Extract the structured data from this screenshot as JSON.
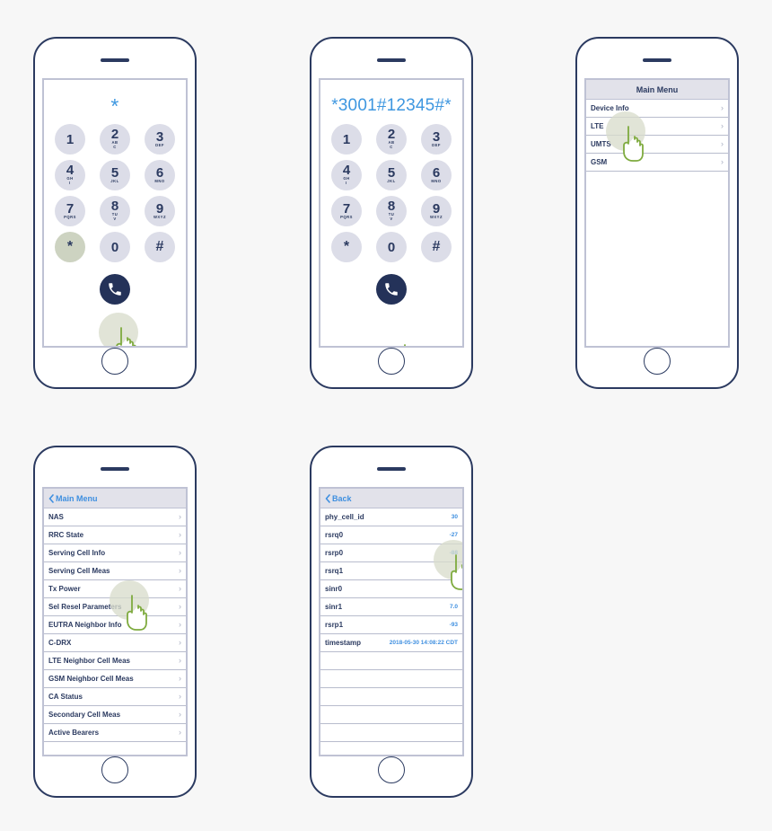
{
  "colors": {
    "frame": "#2b3a60",
    "screen_border": "#bfc2d4",
    "key_bg": "#dcdde8",
    "key_highlight": "#cdd3c1",
    "call_button": "#243259",
    "accent_blue": "#3e8fe0",
    "display_blue": "#3e97e0",
    "header_bg": "#e2e2ea",
    "row_divider": "#b8bccd",
    "hand_outline": "#7fab3f",
    "halo": "#d8ddcc",
    "page_bg": "#f7f7f7"
  },
  "keypad": {
    "keys": [
      {
        "num": "1",
        "sub": ""
      },
      {
        "num": "2",
        "sub": "AB\nC"
      },
      {
        "num": "3",
        "sub": "DEF"
      },
      {
        "num": "4",
        "sub": "GH\nI"
      },
      {
        "num": "5",
        "sub": "JKL"
      },
      {
        "num": "6",
        "sub": "MNO"
      },
      {
        "num": "7",
        "sub": "PQRS"
      },
      {
        "num": "8",
        "sub": "TU\nV"
      },
      {
        "num": "9",
        "sub": "WXYZ"
      },
      {
        "num": "*",
        "sub": ""
      },
      {
        "num": "0",
        "sub": ""
      },
      {
        "num": "#",
        "sub": ""
      }
    ],
    "call_icon": "phone-handset-icon"
  },
  "phone1": {
    "name": "dialer-star",
    "display": "*",
    "highlight_key": "*",
    "tap_target": "star-key"
  },
  "phone2": {
    "name": "dialer-code-entered",
    "display": "*3001#12345#*",
    "tap_target": "call-button"
  },
  "phone3": {
    "name": "main-menu",
    "header": {
      "title": "Main Menu"
    },
    "items": [
      {
        "label": "Device Info"
      },
      {
        "label": "LTE"
      },
      {
        "label": "UMTS"
      },
      {
        "label": "GSM"
      }
    ],
    "tap_target": "LTE"
  },
  "phone4": {
    "name": "lte-submenu",
    "header": {
      "back_label": "Main Menu"
    },
    "items": [
      {
        "label": "NAS"
      },
      {
        "label": "RRC State"
      },
      {
        "label": "Serving Cell Info"
      },
      {
        "label": "Serving Cell Meas"
      },
      {
        "label": "Tx Power"
      },
      {
        "label": "Sel Resel Parameters"
      },
      {
        "label": "EUTRA Neighbor Info"
      },
      {
        "label": "C-DRX"
      },
      {
        "label": "LTE Neighbor Cell Meas"
      },
      {
        "label": "GSM Neighbor Cell Meas"
      },
      {
        "label": "CA Status"
      },
      {
        "label": "Secondary Cell Meas"
      },
      {
        "label": "Active Bearers"
      }
    ],
    "tap_target": "Serving Cell Meas"
  },
  "phone5": {
    "name": "serving-cell-meas",
    "header": {
      "back_label": "Back"
    },
    "rows": [
      {
        "label": "phy_cell_id",
        "value": "30"
      },
      {
        "label": "rsrq0",
        "value": "-27"
      },
      {
        "label": "rsrp0",
        "value": "-88"
      },
      {
        "label": "rsrq1",
        "value": ""
      },
      {
        "label": "sinr0",
        "value": ""
      },
      {
        "label": "sinr1",
        "value": "7.0"
      },
      {
        "label": "rsrp1",
        "value": "-93"
      },
      {
        "label": "timestamp",
        "value": "2018-05-30 14:08:22 CDT"
      },
      {
        "label": "",
        "value": ""
      },
      {
        "label": "",
        "value": ""
      },
      {
        "label": "",
        "value": ""
      },
      {
        "label": "",
        "value": ""
      },
      {
        "label": "",
        "value": ""
      }
    ],
    "tap_target": "rsrp0"
  },
  "icons": {
    "hand_cursor": "hand-pointer-icon",
    "chevron_right": "chevron-right-icon",
    "chevron_left": "chevron-left-icon",
    "speaker": "speaker-grille-icon",
    "home": "home-button-icon"
  }
}
